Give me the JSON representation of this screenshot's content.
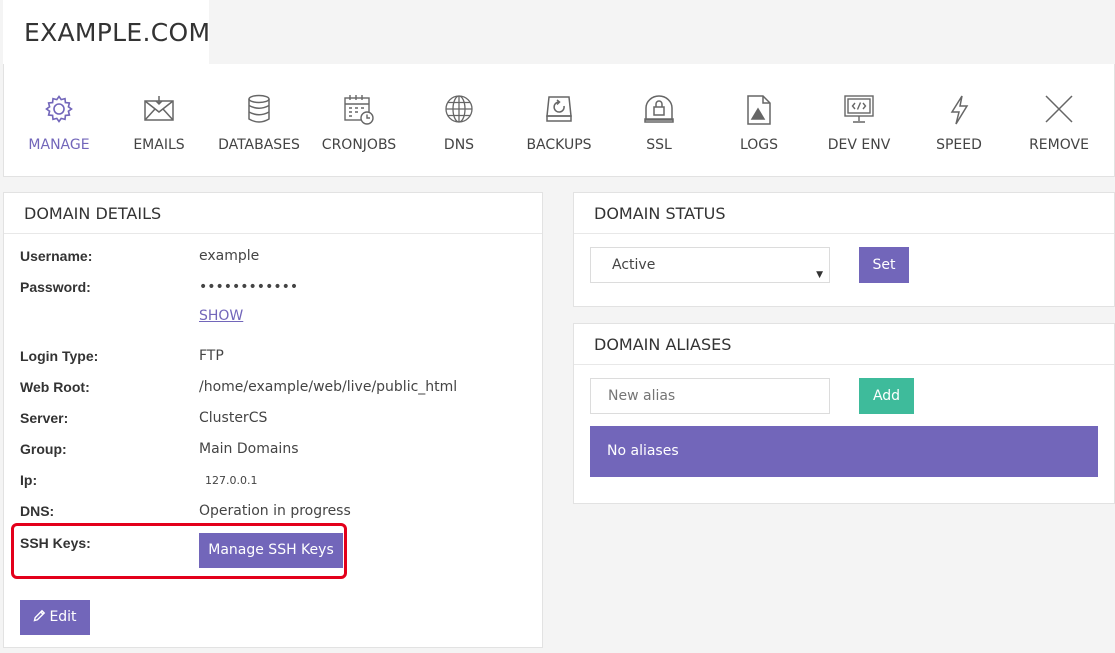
{
  "site": {
    "title": "EXAMPLE.COM"
  },
  "nav": {
    "items": [
      {
        "label": "MANAGE",
        "icon": "gear-icon"
      },
      {
        "label": "EMAILS",
        "icon": "envelope-icon"
      },
      {
        "label": "DATABASES",
        "icon": "database-icon"
      },
      {
        "label": "CRONJOBS",
        "icon": "calendar-clock-icon"
      },
      {
        "label": "DNS",
        "icon": "globe-icon"
      },
      {
        "label": "BACKUPS",
        "icon": "backup-drive-icon"
      },
      {
        "label": "SSL",
        "icon": "lock-icon"
      },
      {
        "label": "LOGS",
        "icon": "log-file-icon"
      },
      {
        "label": "DEV ENV",
        "icon": "monitor-code-icon"
      },
      {
        "label": "SPEED",
        "icon": "lightning-icon"
      },
      {
        "label": "REMOVE",
        "icon": "close-icon"
      }
    ],
    "active_color": "#7266ba"
  },
  "domain_details": {
    "title": "DOMAIN DETAILS",
    "username_label": "Username:",
    "username": "example",
    "password_label": "Password:",
    "password": "••••••••••••",
    "show_label": "SHOW",
    "login_type_label": "Login Type:",
    "login_type": "FTP",
    "web_root_label": "Web Root:",
    "web_root": "/home/example/web/live/public_html",
    "server_label": "Server:",
    "server": "ClusterCS",
    "group_label": "Group:",
    "group": "Main Domains",
    "ip_label": "Ip:",
    "ip": "127.0.0.1",
    "dns_label": "DNS:",
    "dns": "Operation in progress",
    "ssh_label": "SSH Keys:",
    "ssh_button": "Manage SSH Keys",
    "edit_button": "Edit"
  },
  "domain_status": {
    "title": "DOMAIN STATUS",
    "selected": "Active",
    "set_button": "Set"
  },
  "domain_aliases": {
    "title": "DOMAIN ALIASES",
    "placeholder": "New alias",
    "add_button": "Add",
    "empty_message": "No aliases"
  },
  "colors": {
    "accent": "#7266ba",
    "success": "#3ebb9b",
    "highlight": "#e3001b"
  }
}
